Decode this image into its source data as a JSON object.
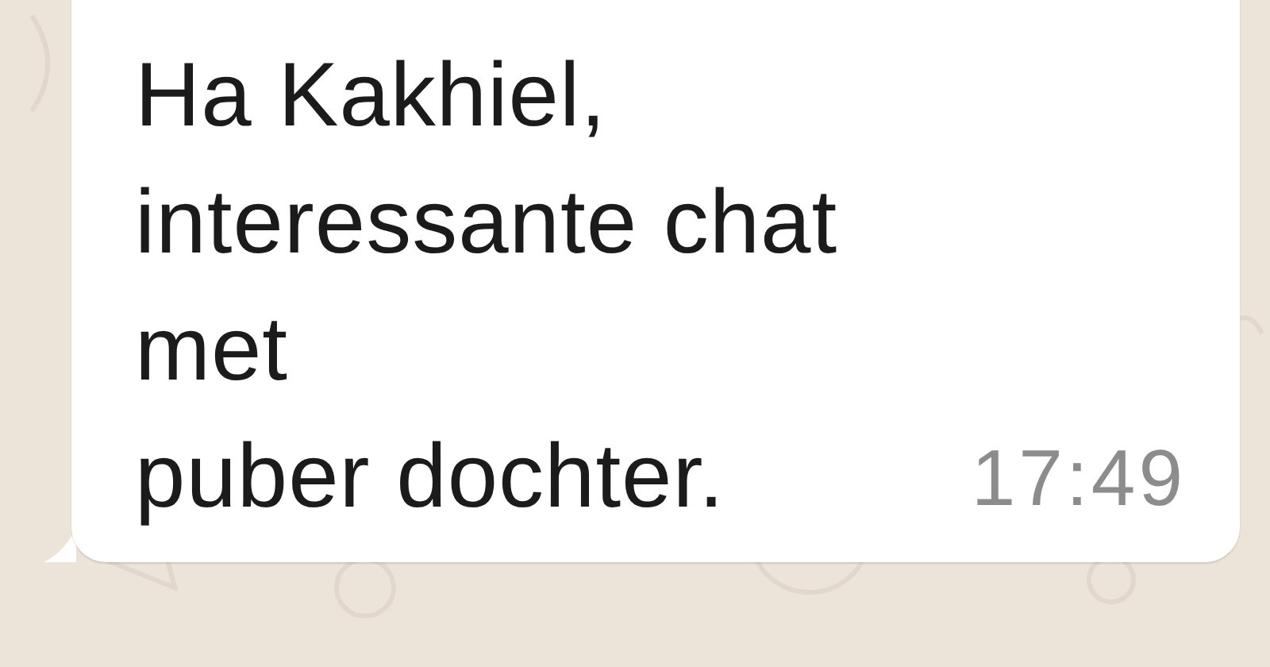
{
  "message": {
    "kind": "incoming",
    "text": "Ha Kakhiel,\ninteressante chat met\npuber dochter.",
    "time": "17:49"
  }
}
